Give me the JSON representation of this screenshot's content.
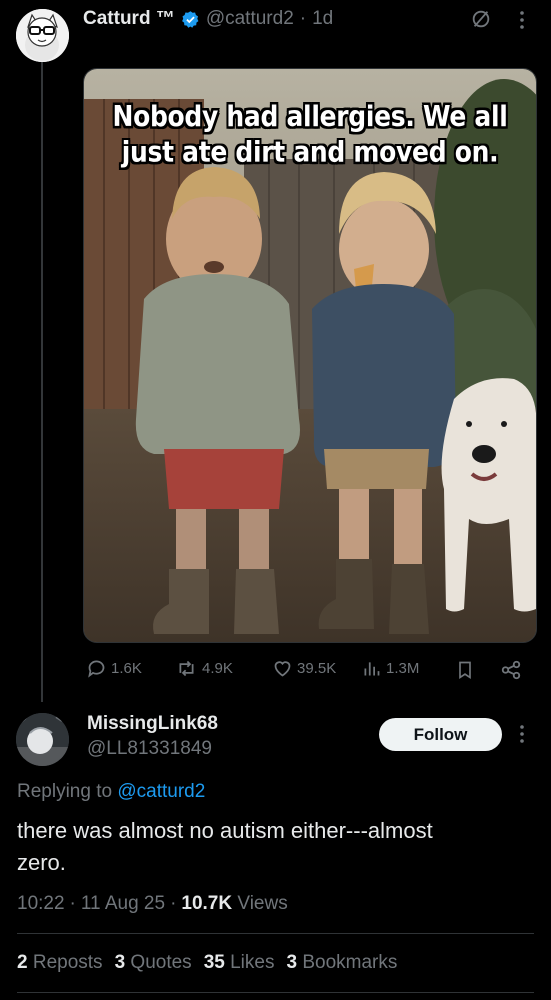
{
  "tweet": {
    "author_name": "Catturd ™",
    "handle": "@catturd2",
    "separator": "·",
    "age": "1d",
    "verified_icon": "verified-badge-icon",
    "meme_text_line1": "Nobody had allergies. We all",
    "meme_text_line2": "just ate dirt and moved on.",
    "actions": {
      "replies": "1.6K",
      "reposts": "4.9K",
      "likes": "39.5K",
      "views": "1.3M"
    }
  },
  "reply": {
    "author_name": "MissingLink68",
    "handle": "@LL81331849",
    "follow_label": "Follow",
    "replying_prefix": "Replying to",
    "replying_handle": "@catturd2",
    "text_line1": "there was almost no autism either---almost",
    "text_line2": "zero.",
    "time": "10:22",
    "date": "11 Aug 25",
    "views_count": "10.7K",
    "views_label": "Views",
    "dot": "·"
  },
  "stats": [
    {
      "count": "2",
      "label": "Reposts"
    },
    {
      "count": "3",
      "label": "Quotes"
    },
    {
      "count": "35",
      "label": "Likes"
    },
    {
      "count": "3",
      "label": "Bookmarks"
    }
  ],
  "colors": {
    "background": "#000000",
    "text": "#e7e9ea",
    "muted": "#71767b",
    "accent": "#1d9bf0",
    "divider": "#2f3336"
  }
}
